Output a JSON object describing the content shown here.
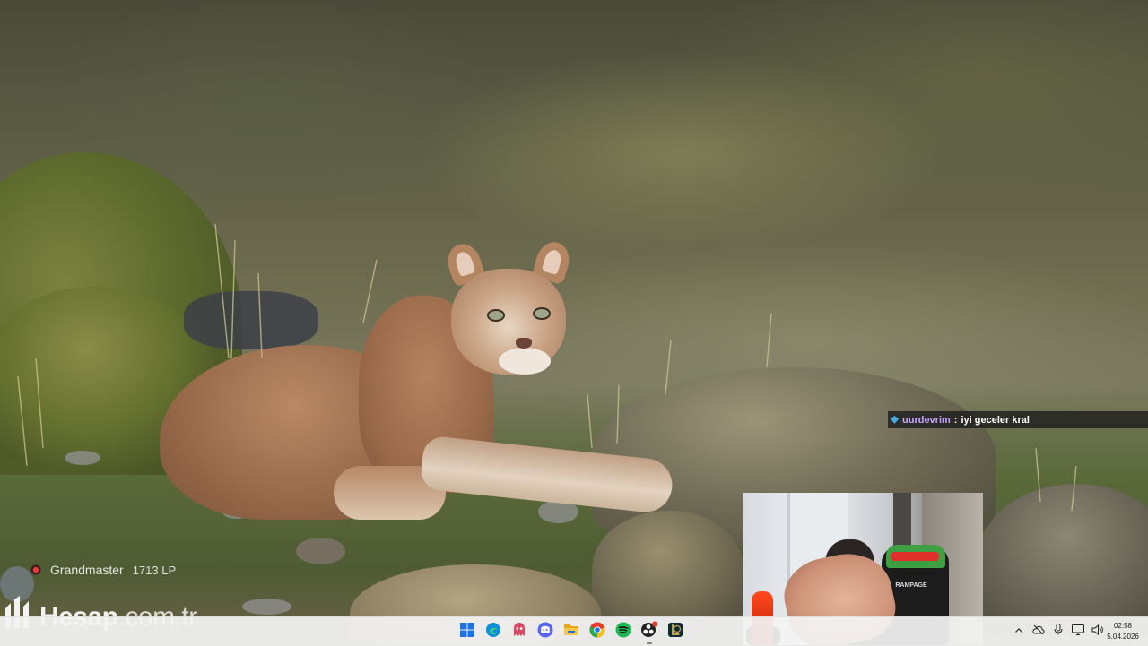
{
  "chat": {
    "username": "uurdevrim",
    "separator": ":",
    "message": "iyi geceler kral",
    "badge_icon": "diamond-badge-icon"
  },
  "rank": {
    "tier": "Grandmaster",
    "lp": "1713 LP",
    "icon": "rank-dot-icon",
    "color": "#e33b3b"
  },
  "watermark": {
    "brand": "Hesap",
    "domain": ".com.tr"
  },
  "webcam": {
    "chair_brand": "RAMPAGE"
  },
  "taskbar": {
    "apps": [
      {
        "name": "start",
        "icon": "windows-start-icon",
        "color": "#1a73e8",
        "active": false
      },
      {
        "name": "edge",
        "icon": "edge-browser-icon",
        "color": "#0f8fd8",
        "active": false
      },
      {
        "name": "app-red",
        "icon": "ghost-app-icon",
        "color": "#d84a63",
        "active": false
      },
      {
        "name": "discord",
        "icon": "discord-icon",
        "color": "#5865f2",
        "active": false
      },
      {
        "name": "file-explorer",
        "icon": "folder-icon",
        "color": "#f2b51c",
        "active": false
      },
      {
        "name": "chrome",
        "icon": "chrome-icon",
        "color": "#e33b2e",
        "active": false
      },
      {
        "name": "spotify",
        "icon": "spotify-icon",
        "color": "#1db954",
        "active": false
      },
      {
        "name": "obs",
        "icon": "obs-icon",
        "color": "#222222",
        "active": true
      },
      {
        "name": "league",
        "icon": "league-client-icon",
        "color": "#c8a04a",
        "active": false
      }
    ],
    "tray": [
      {
        "name": "show-hidden",
        "icon": "chevron-up-icon"
      },
      {
        "name": "cloud",
        "icon": "cloud-off-icon"
      },
      {
        "name": "mic",
        "icon": "microphone-icon"
      },
      {
        "name": "display",
        "icon": "monitor-icon"
      },
      {
        "name": "volume",
        "icon": "speaker-icon"
      }
    ],
    "time": "02:58",
    "date": "5.04.2026"
  }
}
